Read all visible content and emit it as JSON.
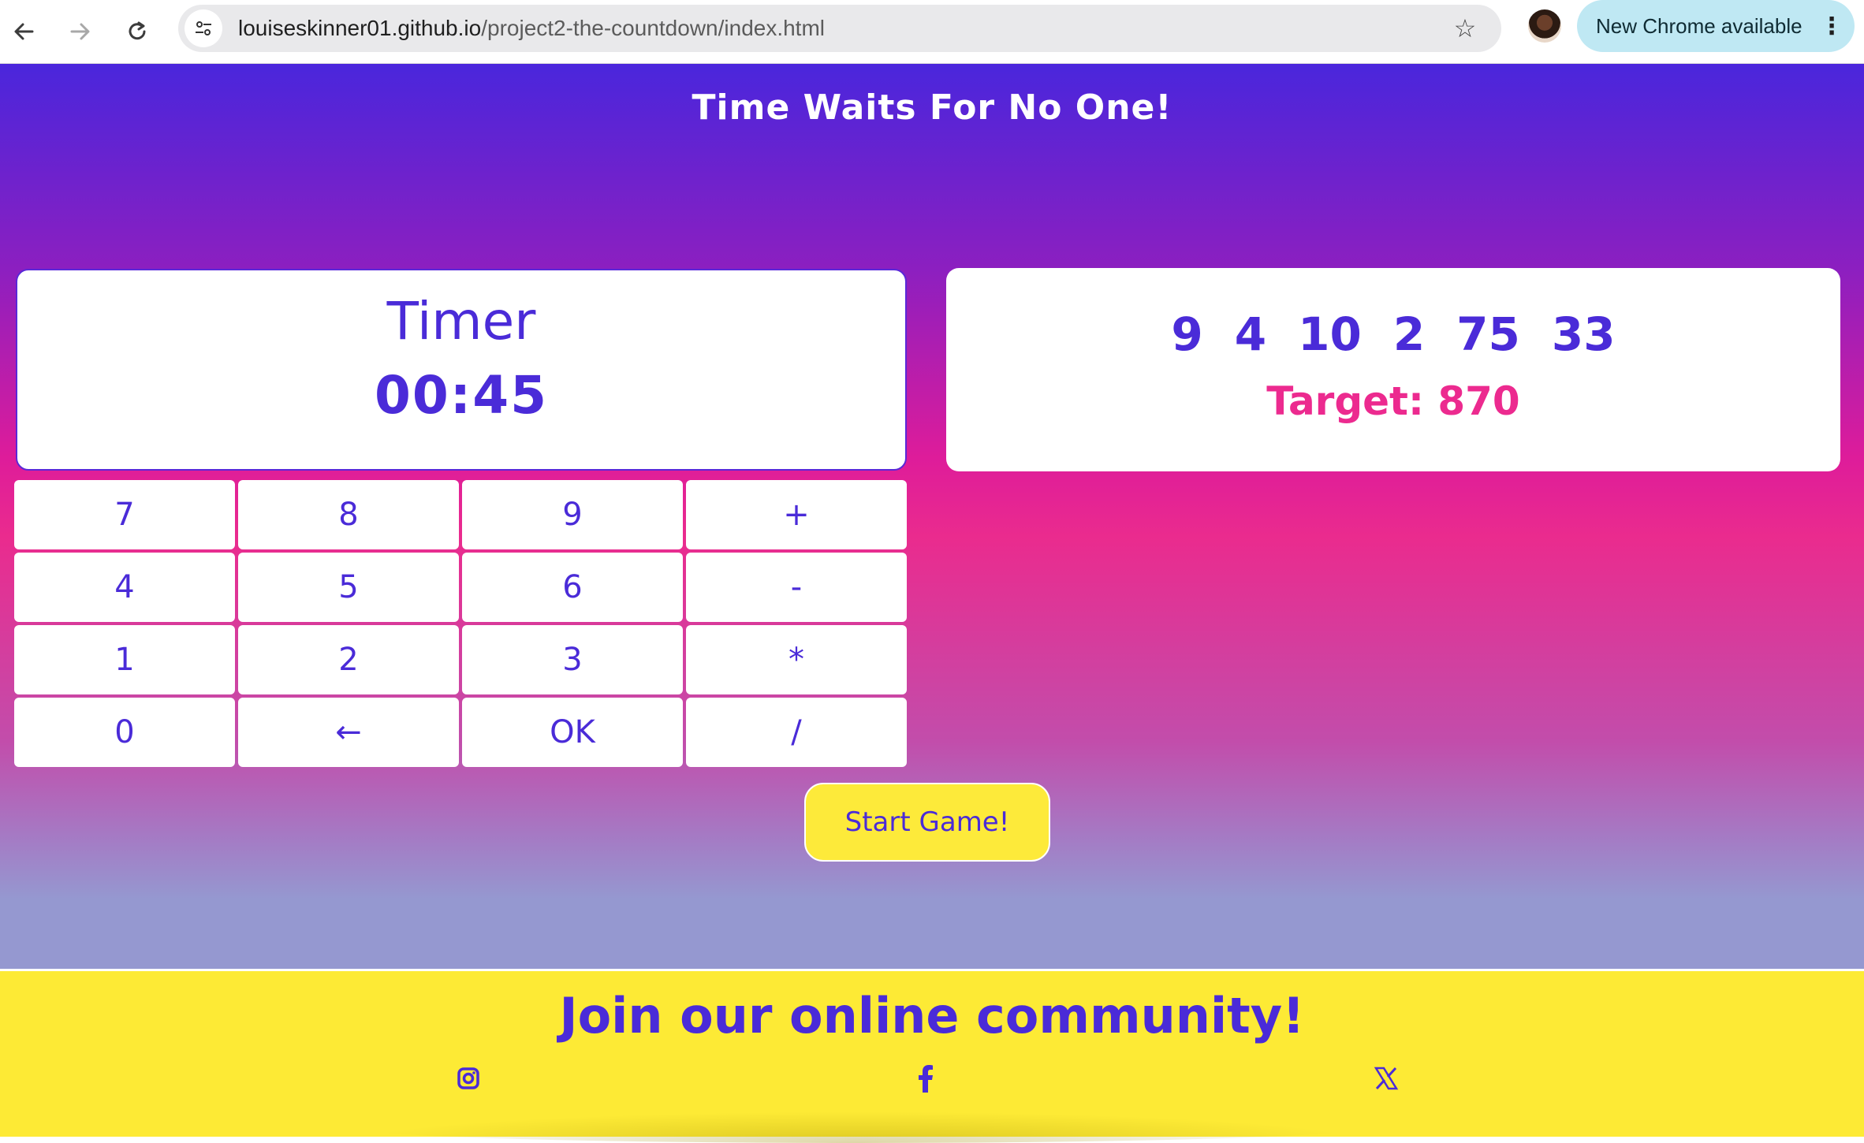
{
  "browser": {
    "url_host": "louiseskinner01.github.io",
    "url_path": "/project2-the-countdown/index.html",
    "update_label": "New Chrome available"
  },
  "page": {
    "headline": "Time Waits For No One!"
  },
  "timer": {
    "title": "Timer",
    "value": "00:45"
  },
  "numbers": {
    "values": [
      "9",
      "4",
      "10",
      "2",
      "75",
      "33"
    ],
    "target_label": "Target: 870"
  },
  "keypad": {
    "keys": [
      "7",
      "8",
      "9",
      "+",
      "4",
      "5",
      "6",
      "-",
      "1",
      "2",
      "3",
      "*",
      "0",
      "←",
      "OK",
      "/"
    ]
  },
  "start_button": {
    "label": "Start Game!"
  },
  "footer": {
    "title": "Join our online community!",
    "social": [
      "instagram-icon",
      "facebook-icon",
      "x-icon"
    ]
  },
  "colors": {
    "accent": "#4a2bd8",
    "target": "#ec2a8f",
    "yellow": "#fdea35"
  }
}
